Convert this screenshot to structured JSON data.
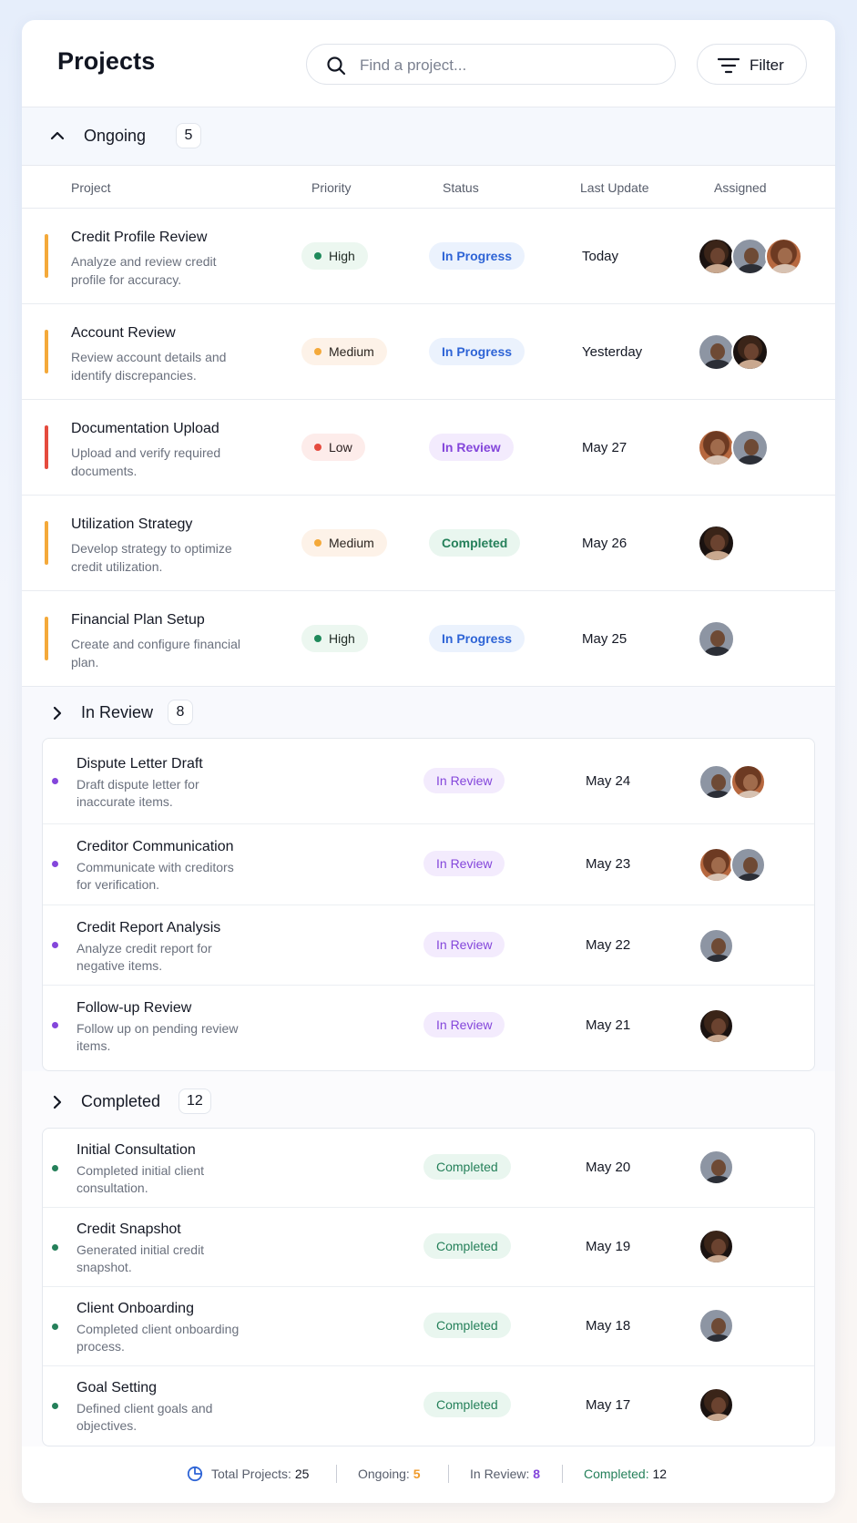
{
  "header": {
    "title": "Projects",
    "search_placeholder": "Find a project...",
    "filter_label": "Filter"
  },
  "columns": {
    "project": "Project",
    "priority": "Priority",
    "status": "Status",
    "last_update": "Last Update",
    "assigned": "Assigned"
  },
  "ongoing": {
    "title": "Ongoing",
    "count": "5",
    "expanded": true,
    "rows": [
      {
        "title": "Credit Profile Review",
        "desc": "Analyze and review credit profile for accuracy.",
        "priority": "High",
        "status": "In Progress",
        "date": "Today",
        "bar_color": "#f4a93a",
        "avatars": [
          "f1",
          "m1",
          "f2"
        ]
      },
      {
        "title": "Account Review",
        "desc": "Review account details and identify discrepancies.",
        "priority": "Medium",
        "status": "In Progress",
        "date": "Yesterday",
        "bar_color": "#f4a93a",
        "avatars": [
          "m1",
          "f1"
        ]
      },
      {
        "title": "Documentation Upload",
        "desc": "Upload and verify required documents.",
        "priority": "Low",
        "status": "In Review",
        "date": "May 27",
        "bar_color": "#e54b3e",
        "avatars": [
          "f2",
          "m1"
        ]
      },
      {
        "title": "Utilization Strategy",
        "desc": "Develop strategy to optimize credit utilization.",
        "priority": "Medium",
        "status": "Completed",
        "date": "May 26",
        "bar_color": "#f4a93a",
        "avatars": [
          "f1"
        ]
      },
      {
        "title": "Financial Plan Setup",
        "desc": "Create and configure financial plan.",
        "priority": "High",
        "status": "In Progress",
        "date": "May 25",
        "bar_color": "#f4a93a",
        "avatars": [
          "m1"
        ]
      }
    ]
  },
  "in_review": {
    "title": "In Review",
    "count": "8",
    "expanded": false,
    "rows": [
      {
        "title": "Dispute Letter Draft",
        "desc": "Draft dispute letter for inaccurate items.",
        "status": "In Review",
        "date": "May 24",
        "avatars": [
          "m1",
          "f2"
        ]
      },
      {
        "title": "Creditor Communication",
        "desc": "Communicate with creditors for verification.",
        "status": "In Review",
        "date": "May 23",
        "avatars": [
          "f2",
          "m1"
        ]
      },
      {
        "title": "Credit Report Analysis",
        "desc": "Analyze credit report for negative items.",
        "status": "In Review",
        "date": "May 22",
        "avatars": [
          "m1"
        ]
      },
      {
        "title": "Follow-up Review",
        "desc": "Follow up on pending review items.",
        "status": "In Review",
        "date": "May 21",
        "avatars": [
          "f1"
        ]
      }
    ]
  },
  "completed": {
    "title": "Completed",
    "count": "12",
    "expanded": false,
    "rows": [
      {
        "title": "Initial Consultation",
        "desc": "Completed initial client consultation.",
        "status": "Completed",
        "date": "May 20",
        "avatars": [
          "m1"
        ]
      },
      {
        "title": "Credit Snapshot",
        "desc": "Generated initial credit snapshot.",
        "status": "Completed",
        "date": "May 19",
        "avatars": [
          "f1"
        ]
      },
      {
        "title": "Client Onboarding",
        "desc": "Completed client onboarding process.",
        "status": "Completed",
        "date": "May 18",
        "avatars": [
          "m1"
        ]
      },
      {
        "title": "Goal Setting",
        "desc": "Defined client goals and objectives.",
        "status": "Completed",
        "date": "May 17",
        "avatars": [
          "f1"
        ]
      }
    ]
  },
  "footer": {
    "total_label": "Total Projects:",
    "total_value": "25",
    "ongoing_label": "Ongoing:",
    "ongoing_value": "5",
    "review_label": "In Review:",
    "review_value": "8",
    "completed_label": "Completed:",
    "completed_value": "12"
  },
  "colors": {
    "accent_blue": "#2e64d6",
    "review_purple": "#8446db",
    "completed_green": "#25805a",
    "ongoing_orange": "#f4a93a",
    "priority_high": "#1f8a5b",
    "priority_medium": "#f4a93a",
    "priority_low": "#e54b3e"
  },
  "icons": {
    "search": "search-icon",
    "filter": "filter-icon",
    "expand": "chevron-up-icon",
    "collapsed": "chevron-right-icon",
    "footer_total": "pie-chart-icon"
  }
}
